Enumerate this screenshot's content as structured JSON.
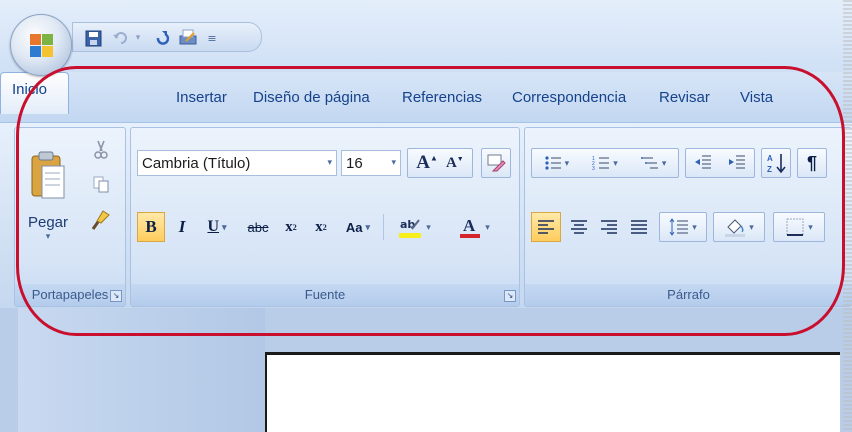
{
  "tabs": [
    "Inicio",
    "Insertar",
    "Diseño de página",
    "Referencias",
    "Correspondencia",
    "Revisar",
    "Vista"
  ],
  "groups": {
    "portapapeles": {
      "label": "Portapapeles",
      "paste_label": "Pegar"
    },
    "fuente": {
      "label": "Fuente",
      "font_name": "Cambria (Título)",
      "font_size": "16"
    },
    "parrafo": {
      "label": "Párrafo"
    }
  },
  "icons": {
    "office": "office-logo-icon",
    "save": "save-icon",
    "undo": "undo-icon",
    "redo": "redo-icon",
    "print": "print-icon"
  },
  "colors": {
    "accent": "#15428b",
    "highlight_ring": "#c8102e",
    "active_button": "#ffcc5c"
  }
}
